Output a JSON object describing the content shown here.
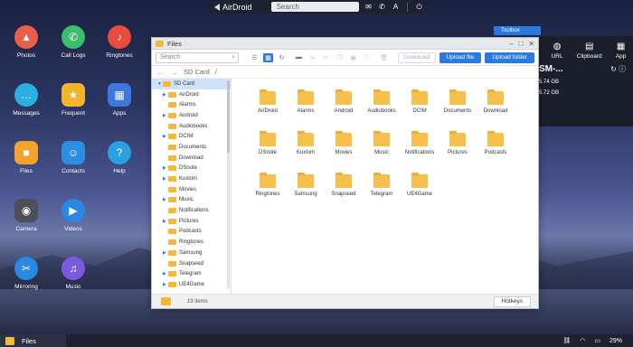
{
  "topbar": {
    "logo": "AirDroid",
    "search_placeholder": "Search"
  },
  "desktop_icons": [
    {
      "label": "Photos",
      "color": "#e8604a",
      "glyph": "▲"
    },
    {
      "label": "Call Logs",
      "color": "#3bbf6a",
      "glyph": "✆"
    },
    {
      "label": "Ringtones",
      "color": "#e84c3d",
      "glyph": "♪"
    },
    {
      "label": "Messages",
      "color": "#2ab0e0",
      "glyph": "…"
    },
    {
      "label": "Frequent",
      "color": "#f2b52c",
      "glyph": "★"
    },
    {
      "label": "Apps",
      "color": "#3b78e0",
      "glyph": "▦"
    },
    {
      "label": "Files",
      "color": "#f2a32c",
      "glyph": "■"
    },
    {
      "label": "Contacts",
      "color": "#2a8fe0",
      "glyph": "☺"
    },
    {
      "label": "Help",
      "color": "#2aa0e0",
      "glyph": "?"
    },
    {
      "label": "Camera",
      "color": "#4a4f5a",
      "glyph": "◉"
    },
    {
      "label": "Videos",
      "color": "#2a88e0",
      "glyph": "▶"
    },
    {
      "label": "Mirroring",
      "color": "#2a88e0",
      "glyph": "✂"
    },
    {
      "label": "Music",
      "color": "#7a5ae0",
      "glyph": "♫"
    }
  ],
  "window": {
    "title": "Files",
    "search_placeholder": "Search",
    "download_label": "Download",
    "upload_file_label": "Upload file",
    "upload_folder_label": "Upload folder",
    "path": "SD Card",
    "path_sep": "/",
    "item_count": "19 items",
    "hotkeys_label": "Hotkeys"
  },
  "tree": {
    "root": "SD Card",
    "children": [
      "AirDroid",
      "Alarms",
      "Android",
      "Audiobooks",
      "DCIM",
      "Documents",
      "Download",
      "DSnote",
      "Kuxlom",
      "Movies",
      "Music",
      "Notifications",
      "Pictures",
      "Podcasts",
      "Ringtones",
      "Samsung",
      "Snapseed",
      "Telegram",
      "UE4Game"
    ],
    "expandable": [
      "AirDroid",
      "Android",
      "DCIM",
      "DSnote",
      "Kuxlom",
      "Music",
      "Pictures",
      "Samsung",
      "Telegram",
      "UE4Game"
    ]
  },
  "folders": [
    "AirDroid",
    "Alarms",
    "Android",
    "Audiobooks",
    "DCIM",
    "Documents",
    "Download",
    "DSnote",
    "Kuxlom",
    "Movies",
    "Music",
    "Notifications",
    "Pictures",
    "Podcasts",
    "Ringtones",
    "Samsung",
    "Snapseed",
    "Telegram",
    "UE4Game"
  ],
  "right_panel": {
    "toolbox": "Toolbox",
    "items": [
      "URL",
      "Clipboard",
      "App"
    ],
    "device_title": "SM-...",
    "storage1": "5.74 GB",
    "storage2": "5.72 GB"
  },
  "taskbar": {
    "app_label": "Files",
    "battery": "29%"
  }
}
